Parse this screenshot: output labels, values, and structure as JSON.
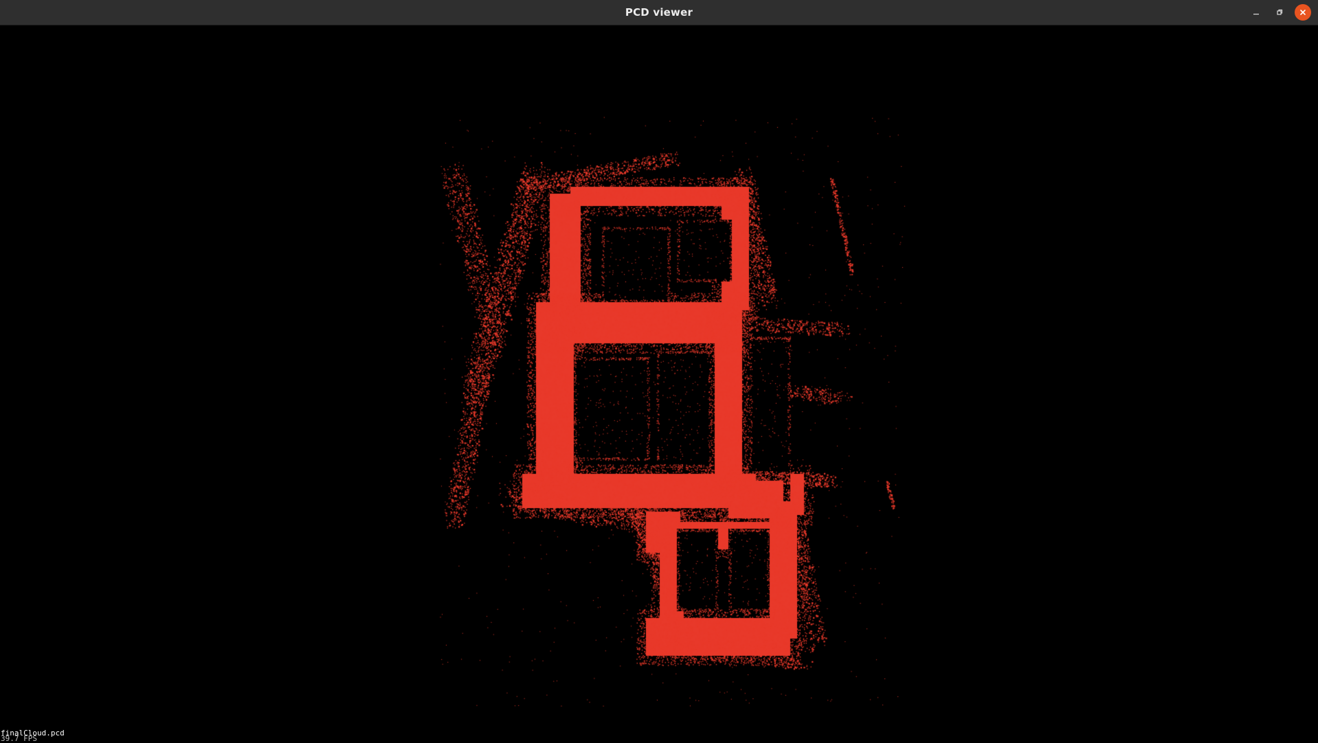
{
  "window": {
    "title": "PCD viewer"
  },
  "controls": {
    "minimize_icon": "minimize-icon",
    "maximize_icon": "restore-icon",
    "close_icon": "close-icon",
    "close_color": "#e95420"
  },
  "viewport": {
    "background": "#000000",
    "point_color": "#e8392a",
    "overlay": {
      "cloud_label": "finalCloud.pcd",
      "fps_label": "39.7 FPS"
    }
  }
}
